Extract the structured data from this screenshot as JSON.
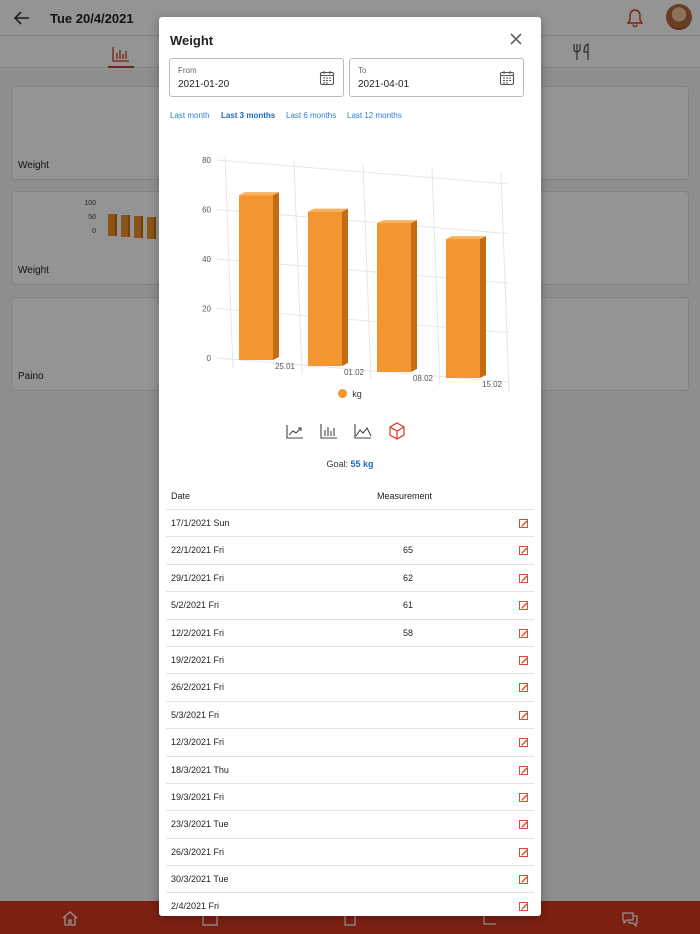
{
  "app": {
    "date": "Tue 20/4/2021"
  },
  "background_cards": [
    {
      "label": "Weight"
    },
    {
      "label": "Weight",
      "mini_chart_ticks": [
        "100",
        "50",
        "0"
      ]
    },
    {
      "label": "Paino"
    }
  ],
  "dialog": {
    "title": "Weight",
    "from": {
      "label": "From",
      "value": "2021-01-20"
    },
    "to": {
      "label": "To",
      "value": "2021-04-01"
    },
    "range_tabs": [
      {
        "label": "Last month",
        "active": false
      },
      {
        "label": "Last 3 months",
        "active": true
      },
      {
        "label": "Last 6 months",
        "active": false
      },
      {
        "label": "Last 12 months",
        "active": false
      }
    ],
    "chart_types": [
      "trend-line-icon",
      "bar-chart-icon",
      "area-chart-icon",
      "3d-cube-icon"
    ],
    "selected_chart_type": "3d-cube-icon",
    "goal": {
      "label": "Goal:",
      "value": "55 kg"
    },
    "table": {
      "headers": {
        "date": "Date",
        "measurement": "Measurement"
      },
      "rows": [
        {
          "date": "17/1/2021 Sun",
          "measurement": ""
        },
        {
          "date": "22/1/2021 Fri",
          "measurement": "65"
        },
        {
          "date": "29/1/2021 Fri",
          "measurement": "62"
        },
        {
          "date": "5/2/2021 Fri",
          "measurement": "61"
        },
        {
          "date": "12/2/2021 Fri",
          "measurement": "58"
        },
        {
          "date": "19/2/2021 Fri",
          "measurement": ""
        },
        {
          "date": "26/2/2021 Fri",
          "measurement": ""
        },
        {
          "date": "5/3/2021 Fri",
          "measurement": ""
        },
        {
          "date": "12/3/2021 Fri",
          "measurement": ""
        },
        {
          "date": "18/3/2021 Thu",
          "measurement": ""
        },
        {
          "date": "19/3/2021 Fri",
          "measurement": ""
        },
        {
          "date": "23/3/2021 Tue",
          "measurement": ""
        },
        {
          "date": "26/3/2021 Fri",
          "measurement": ""
        },
        {
          "date": "30/3/2021 Tue",
          "measurement": ""
        },
        {
          "date": "2/4/2021 Fri",
          "measurement": ""
        }
      ]
    }
  },
  "colors": {
    "accent": "#d6371f",
    "bar": "#f39530",
    "link": "#2a7fd4"
  },
  "chart_data": {
    "type": "bar",
    "categories": [
      "25.01",
      "01.02",
      "08.02",
      "15.02"
    ],
    "series": [
      {
        "name": "kg",
        "values": [
          65,
          62,
          61,
          58
        ]
      }
    ],
    "ylim": [
      0,
      80
    ],
    "yticks": [
      "0",
      "20",
      "40",
      "60",
      "80"
    ],
    "grid": true,
    "legend": "bottom",
    "style": "3d"
  }
}
